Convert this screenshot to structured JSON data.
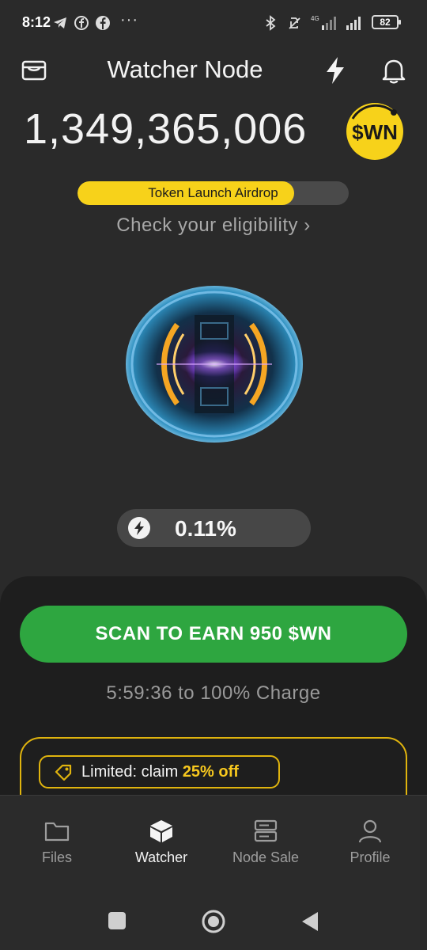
{
  "status_bar": {
    "time": "8:12",
    "battery": "82",
    "network": "4G"
  },
  "header": {
    "title": "Watcher Node",
    "wallet_icon": "wallet-icon",
    "boost_icon": "lightning-icon",
    "notifications_icon": "bell-icon"
  },
  "balance": {
    "amount": "1,349,365,006",
    "token_symbol": "$WN"
  },
  "airdrop": {
    "label": "Token Launch Airdrop",
    "progress_fraction": 0.8,
    "link_text": "Check your eligibility",
    "chevron": "›"
  },
  "energy": {
    "value": "0.11%"
  },
  "scan": {
    "button_label": "SCAN TO EARN 950 $WN",
    "countdown_text": "5:59:36 to 100% Charge"
  },
  "promo": {
    "prefix": "Limited: claim ",
    "highlight": "25% off"
  },
  "tabs": [
    {
      "label": "Files",
      "icon": "folder-icon"
    },
    {
      "label": "Watcher",
      "icon": "cube-icon"
    },
    {
      "label": "Node Sale",
      "icon": "server-icon"
    },
    {
      "label": "Profile",
      "icon": "user-icon"
    }
  ],
  "colors": {
    "accent_yellow": "#f7d21a",
    "scan_green": "#2ea640",
    "background": "#2a2a2a"
  }
}
